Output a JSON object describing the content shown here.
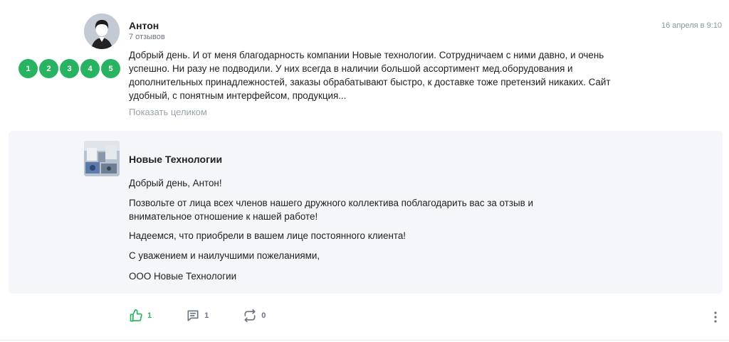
{
  "review": {
    "author": "Антон",
    "reviews_count": "7 отзывов",
    "date": "16 апреля в 9:10",
    "text": "Добрый день. И от меня благодарность компании Новые технологии. Сотрудничаем с ними давно, и очень успешно. Ни разу не подводили. У них всегда в наличии большой ассортимент мед.оборудования и дополнительных принадлежностей, заказы обрабатывают быстро, к доставке тоже претензий никаких. Сайт удобный, с понятным интерфейсом, продукция...",
    "show_full_label": "Показать целиком",
    "ratings": [
      "1",
      "2",
      "3",
      "4",
      "5"
    ]
  },
  "reply": {
    "company": "Новые Технологии",
    "lines": [
      "Добрый день, Антон!",
      "Позвольте от лица всех членов нашего дружного коллектива поблагодарить вас за отзыв и внимательное отношение к нашей работе!",
      "Надеемся, что приобрели в вашем лице постоянного клиента!",
      "С уважением и наилучшими пожеланиями,",
      "ООО Новые Технологии"
    ]
  },
  "actions": {
    "likes": "1",
    "comments": "1",
    "reposts": "0"
  },
  "colors": {
    "accent_green": "#27b361",
    "reply_bg": "#f4f6f9",
    "muted_text": "#9aa3ad"
  },
  "icons": [
    "avatar-user-icon",
    "company-logo-image",
    "thumbs-up-icon",
    "comment-icon",
    "repost-icon",
    "more-vertical-icon"
  ]
}
